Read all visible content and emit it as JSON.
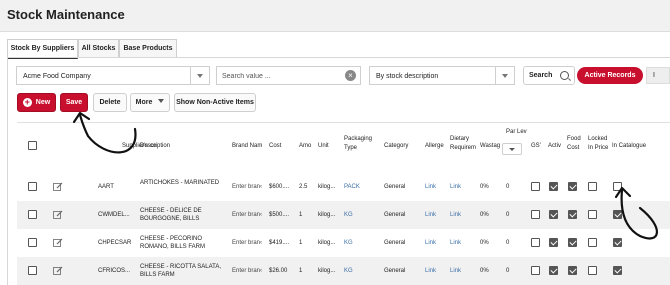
{
  "page_title": "Stock Maintenance",
  "tabs": [
    "Stock By Suppliers",
    "All Stocks",
    "Base Products"
  ],
  "filters": {
    "supplier": "Acme Food Company",
    "search_placeholder": "Search value ...",
    "clear_glyph": "×",
    "search_mode": "By stock description",
    "search_button": "Search",
    "active_records": "Active Records",
    "trailing": "I"
  },
  "toolbar": {
    "new": "New",
    "save": "Save",
    "delete": "Delete",
    "more": "More",
    "show_non_active": "Show Non-Active Items"
  },
  "columns": {
    "supplier_code": "Supplier's co",
    "description": "Description",
    "brand_name": "Brand Nam",
    "cost": "Cost",
    "amount": "Amo",
    "unit": "Unit",
    "packaging_type_1": "Packaging",
    "packaging_type_2": "Type",
    "category": "Category",
    "allergens": "Allerge",
    "dietary_1": "Dietary",
    "dietary_2": "Requirem",
    "wastage": "Wastag",
    "par_level": "Par Lev",
    "gst": "GS'",
    "active": "Activ",
    "food_cost_1": "Food",
    "food_cost_2": "Cost",
    "locked_1": "Locked",
    "locked_2": "In Price",
    "in_catalogue": "In Catalogue"
  },
  "rows": [
    {
      "code": "AART",
      "desc1": "ARTICHOKES - MARINATED",
      "desc2": "",
      "brand": "Enter bran‹",
      "cost": "$600....",
      "amount": "2.5",
      "unit": "kilog...",
      "pack": "PACK",
      "category": "General",
      "allergens": "Link",
      "dietary": "Link",
      "wastage": "0%",
      "par": "0",
      "gst": false,
      "active": true,
      "food_cost": true,
      "locked": false,
      "catalogue": false
    },
    {
      "code": "CWMDEL...",
      "desc1": "CHEESE - DELICE DE",
      "desc2": "BOURGOGNE, BILLS",
      "brand": "Enter bran‹",
      "cost": "$500....",
      "amount": "1",
      "unit": "kilog...",
      "pack": "KG",
      "category": "General",
      "allergens": "Link",
      "dietary": "Link",
      "wastage": "0%",
      "par": "0",
      "gst": false,
      "active": true,
      "food_cost": true,
      "locked": false,
      "catalogue": true
    },
    {
      "code": "CHPECSAR",
      "desc1": "CHEESE - PECORINO",
      "desc2": "ROMANO, BILLS FARM",
      "brand": "Enter bran‹",
      "cost": "$419....",
      "amount": "1",
      "unit": "kilog...",
      "pack": "KG",
      "category": "General",
      "allergens": "Link",
      "dietary": "Link",
      "wastage": "0%",
      "par": "0",
      "gst": false,
      "active": true,
      "food_cost": true,
      "locked": false,
      "catalogue": true
    },
    {
      "code": "CFRICOS...",
      "desc1": "CHEESE - RICOTTA SALATA,",
      "desc2": "BILLS FARM",
      "brand": "Enter bran‹",
      "cost": "$26.00",
      "amount": "1",
      "unit": "kilog...",
      "pack": "KG",
      "category": "General",
      "allergens": "Link",
      "dietary": "Link",
      "wastage": "0%",
      "par": "0",
      "gst": false,
      "active": true,
      "food_cost": true,
      "locked": false,
      "catalogue": true
    }
  ],
  "colors": {
    "accent": "#c8102e",
    "link": "#3a6ea5",
    "row_alt": "#f1f1f1"
  }
}
